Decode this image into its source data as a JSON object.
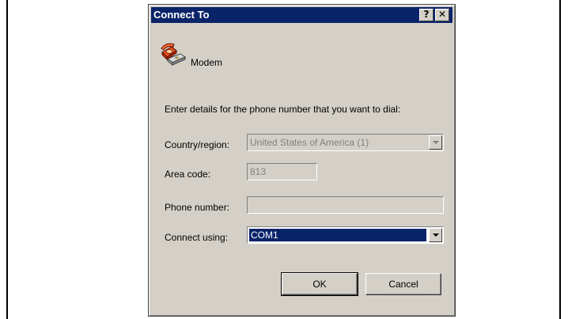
{
  "dialog": {
    "title": "Connect To",
    "help_label": "?",
    "close_label": "✕",
    "connection_name": "Modem",
    "instructions": "Enter details for the phone number that you want to dial:"
  },
  "fields": {
    "country_label": "Country/region:",
    "country_value": "United States of America (1)",
    "area_code_label": "Area code:",
    "area_code_value": "813",
    "phone_label": "Phone number:",
    "phone_value": "",
    "connect_label": "Connect using:",
    "connect_value": "COM1"
  },
  "buttons": {
    "ok": "OK",
    "cancel": "Cancel"
  },
  "colors": {
    "titlebar": "#0a246a",
    "dialog_face": "#d4d0c8",
    "selection": "#0a246a"
  },
  "icons": {
    "connection": "telephone-modem-icon",
    "help": "help-icon",
    "close": "close-icon",
    "dropdown": "chevron-down-icon"
  }
}
